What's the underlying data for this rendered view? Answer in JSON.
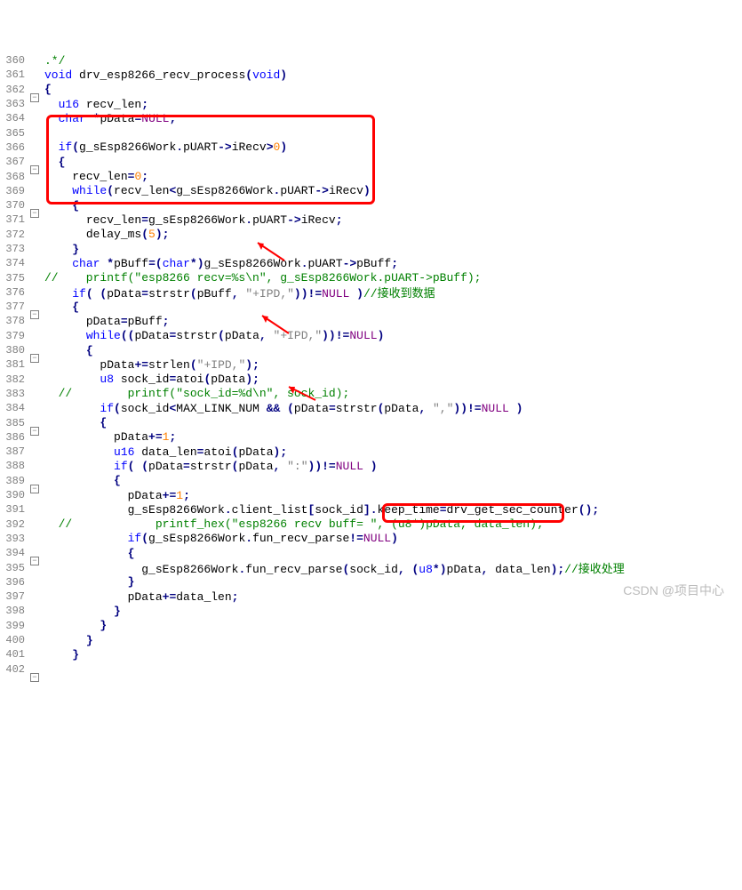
{
  "watermark": "CSDN @项目中心",
  "lines": [
    {
      "num": "360",
      "fold": "line",
      "html": "<span class='comment'>.*/</span>"
    },
    {
      "num": "361",
      "fold": "line",
      "html": "<span class='kw'>void</span> <span class='txt'>drv_esp8266_recv_process</span><span class='op'>(</span><span class='kw'>void</span><span class='op'>)</span>"
    },
    {
      "num": "362",
      "fold": "minus",
      "html": "<span class='op'>{</span>"
    },
    {
      "num": "363",
      "fold": "line",
      "html": "  <span class='kw'>u16</span> <span class='txt'>recv_len</span><span class='op'>;</span>"
    },
    {
      "num": "364",
      "fold": "line",
      "html": "  <span class='kw'>char</span> <span class='op'>*</span><span class='txt'>pData</span><span class='op'>=</span><span class='null'>NULL</span><span class='op'>;</span>"
    },
    {
      "num": "365",
      "fold": "line",
      "html": ""
    },
    {
      "num": "366",
      "fold": "line",
      "html": "  <span class='kw'>if</span><span class='op'>(</span><span class='txt'>g_sEsp8266Work</span><span class='op'>.</span><span class='txt'>pUART</span><span class='op'>-&gt;</span><span class='txt'>iRecv</span><span class='op'>&gt;</span><span class='num'>0</span><span class='op'>)</span>"
    },
    {
      "num": "367",
      "fold": "minus",
      "html": "  <span class='op'>{</span>"
    },
    {
      "num": "368",
      "fold": "line",
      "html": "    <span class='txt'>recv_len</span><span class='op'>=</span><span class='num'>0</span><span class='op'>;</span>"
    },
    {
      "num": "369",
      "fold": "line",
      "html": "    <span class='kw'>while</span><span class='op'>(</span><span class='txt'>recv_len</span><span class='op'>&lt;</span><span class='txt'>g_sEsp8266Work</span><span class='op'>.</span><span class='txt'>pUART</span><span class='op'>-&gt;</span><span class='txt'>iRecv</span><span class='op'>)</span>"
    },
    {
      "num": "370",
      "fold": "minus",
      "html": "    <span class='op'>{</span>"
    },
    {
      "num": "371",
      "fold": "line",
      "html": "      <span class='txt'>recv_len</span><span class='op'>=</span><span class='txt'>g_sEsp8266Work</span><span class='op'>.</span><span class='txt'>pUART</span><span class='op'>-&gt;</span><span class='txt'>iRecv</span><span class='op'>;</span>"
    },
    {
      "num": "372",
      "fold": "line",
      "html": "      <span class='txt'>delay_ms</span><span class='op'>(</span><span class='num'>5</span><span class='op'>);</span>"
    },
    {
      "num": "373",
      "fold": "line",
      "html": "    <span class='op'>}</span>"
    },
    {
      "num": "374",
      "fold": "line",
      "html": "    <span class='kw'>char</span> <span class='op'>*</span><span class='txt'>pBuff</span><span class='op'>=(</span><span class='kw'>char</span><span class='op'>*)</span><span class='txt'>g_sEsp8266Work</span><span class='op'>.</span><span class='txt'>pUART</span><span class='op'>-&gt;</span><span class='txt'>pBuff</span><span class='op'>;</span>"
    },
    {
      "num": "375",
      "fold": "line",
      "html": "<span class='comment'>//    printf(\"esp8266 recv=%s\\n\", g_sEsp8266Work.pUART-&gt;pBuff);</span>"
    },
    {
      "num": "376",
      "fold": "line",
      "html": "    <span class='kw'>if</span><span class='op'>( (</span><span class='txt'>pData</span><span class='op'>=</span><span class='txt'>strstr</span><span class='op'>(</span><span class='txt'>pBuff</span><span class='op'>, </span><span class='str'>\"+IPD,\"</span><span class='op'>))!=</span><span class='null'>NULL</span> <span class='op'>)</span><span class='comment'>//接收到数据</span>"
    },
    {
      "num": "377",
      "fold": "minus",
      "html": "    <span class='op'>{</span>"
    },
    {
      "num": "378",
      "fold": "line",
      "html": "      <span class='txt'>pData</span><span class='op'>=</span><span class='txt'>pBuff</span><span class='op'>;</span>"
    },
    {
      "num": "379",
      "fold": "line",
      "html": "      <span class='kw'>while</span><span class='op'>((</span><span class='txt'>pData</span><span class='op'>=</span><span class='txt'>strstr</span><span class='op'>(</span><span class='txt'>pData</span><span class='op'>, </span><span class='str'>\"+IPD,\"</span><span class='op'>))!=</span><span class='null'>NULL</span><span class='op'>)</span>"
    },
    {
      "num": "380",
      "fold": "minus",
      "html": "      <span class='op'>{</span>"
    },
    {
      "num": "381",
      "fold": "line",
      "html": "        <span class='txt'>pData</span><span class='op'>+=</span><span class='txt'>strlen</span><span class='op'>(</span><span class='str'>\"+IPD,\"</span><span class='op'>);</span>"
    },
    {
      "num": "382",
      "fold": "line",
      "html": "        <span class='kw'>u8</span> <span class='txt'>sock_id</span><span class='op'>=</span><span class='txt'>atoi</span><span class='op'>(</span><span class='txt'>pData</span><span class='op'>);</span>"
    },
    {
      "num": "383",
      "fold": "line",
      "html": "  <span class='comment'>//        printf(\"sock_id=%d\\n\", sock_id);</span>"
    },
    {
      "num": "384",
      "fold": "line",
      "html": "        <span class='kw'>if</span><span class='op'>(</span><span class='txt'>sock_id</span><span class='op'>&lt;</span><span class='txt'>MAX_LINK_NUM</span> <span class='op'>&amp;&amp; (</span><span class='txt'>pData</span><span class='op'>=</span><span class='txt'>strstr</span><span class='op'>(</span><span class='txt'>pData</span><span class='op'>, </span><span class='str'>\",\"</span><span class='op'>))!=</span><span class='null'>NULL</span> <span class='op'>)</span>"
    },
    {
      "num": "385",
      "fold": "minus",
      "html": "        <span class='op'>{</span>"
    },
    {
      "num": "386",
      "fold": "line",
      "html": "          <span class='txt'>pData</span><span class='op'>+=</span><span class='num'>1</span><span class='op'>;</span>"
    },
    {
      "num": "387",
      "fold": "line",
      "html": "          <span class='kw'>u16</span> <span class='txt'>data_len</span><span class='op'>=</span><span class='txt'>atoi</span><span class='op'>(</span><span class='txt'>pData</span><span class='op'>);</span>"
    },
    {
      "num": "388",
      "fold": "line",
      "html": "          <span class='kw'>if</span><span class='op'>( (</span><span class='txt'>pData</span><span class='op'>=</span><span class='txt'>strstr</span><span class='op'>(</span><span class='txt'>pData</span><span class='op'>, </span><span class='str'>\":\"</span><span class='op'>))!=</span><span class='null'>NULL</span> <span class='op'>)</span>"
    },
    {
      "num": "389",
      "fold": "minus",
      "html": "          <span class='op'>{</span>"
    },
    {
      "num": "390",
      "fold": "line",
      "html": "            <span class='txt'>pData</span><span class='op'>+=</span><span class='num'>1</span><span class='op'>;</span>"
    },
    {
      "num": "391",
      "fold": "line",
      "html": "            <span class='txt'>g_sEsp8266Work</span><span class='op'>.</span><span class='txt'>client_list</span><span class='op'>[</span><span class='txt'>sock_id</span><span class='op'>].</span><span class='txt'>keep_time</span><span class='op'>=</span><span class='txt'>drv_get_sec_counter</span><span class='op'>();</span>"
    },
    {
      "num": "392",
      "fold": "line",
      "html": "  <span class='comment'>//            printf_hex(\"esp8266 recv buff= \", (u8*)pData, data_len);</span>"
    },
    {
      "num": "393",
      "fold": "line",
      "html": "            <span class='kw'>if</span><span class='op'>(</span><span class='txt'>g_sEsp8266Work</span><span class='op'>.</span><span class='txt'>fun_recv_parse</span><span class='op'>!=</span><span class='null'>NULL</span><span class='op'>)</span>"
    },
    {
      "num": "394",
      "fold": "minus",
      "html": "            <span class='op'>{</span>"
    },
    {
      "num": "395",
      "fold": "line",
      "html": "              <span class='txt'>g_sEsp8266Work</span><span class='op'>.</span><span class='txt'>fun_recv_parse</span><span class='op'>(</span><span class='txt'>sock_id</span><span class='op'>, (</span><span class='kw'>u8</span><span class='op'>*)</span><span class='txt'>pData</span><span class='op'>, </span><span class='txt'>data_len</span><span class='op'>);</span><span class='comment'>//接收处理</span>"
    },
    {
      "num": "396",
      "fold": "line",
      "html": "            <span class='op'>}</span>"
    },
    {
      "num": "397",
      "fold": "line",
      "html": "            <span class='txt'>pData</span><span class='op'>+=</span><span class='txt'>data_len</span><span class='op'>;</span>"
    },
    {
      "num": "398",
      "fold": "line",
      "html": "          <span class='op'>}</span>"
    },
    {
      "num": "399",
      "fold": "line",
      "html": "        <span class='op'>}</span>"
    },
    {
      "num": "400",
      "fold": "line",
      "html": "      <span class='op'>}</span>"
    },
    {
      "num": "401",
      "fold": "line",
      "html": "    <span class='op'>}</span>"
    },
    {
      "num": "402",
      "fold": "minus",
      "html": ""
    }
  ]
}
